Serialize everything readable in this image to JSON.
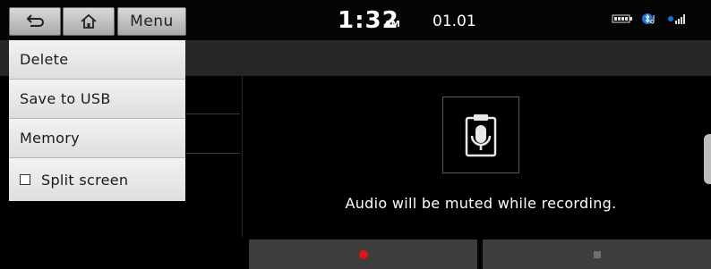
{
  "status": {
    "time": "1:32",
    "ampm": "AM",
    "date": "01.01",
    "icons": [
      "battery-icon",
      "bluetooth-icon",
      "signal-icon"
    ]
  },
  "topbar": {
    "back_icon": "back-arrow-icon",
    "home_icon": "home-icon",
    "menu_label": "Menu"
  },
  "menu": {
    "items": [
      {
        "label": "Delete"
      },
      {
        "label": "Save to USB"
      },
      {
        "label": "Memory"
      },
      {
        "label": "Split screen",
        "checkbox": false
      }
    ]
  },
  "recorder": {
    "icon": "voice-memo-icon",
    "message": "Audio will be muted while recording.",
    "record_icon": "record-dot-icon",
    "stop_icon": "stop-square-icon"
  },
  "colors": {
    "record": "#e01515",
    "menu_bg": "#e9e9e9",
    "title_bar": "#262626"
  }
}
